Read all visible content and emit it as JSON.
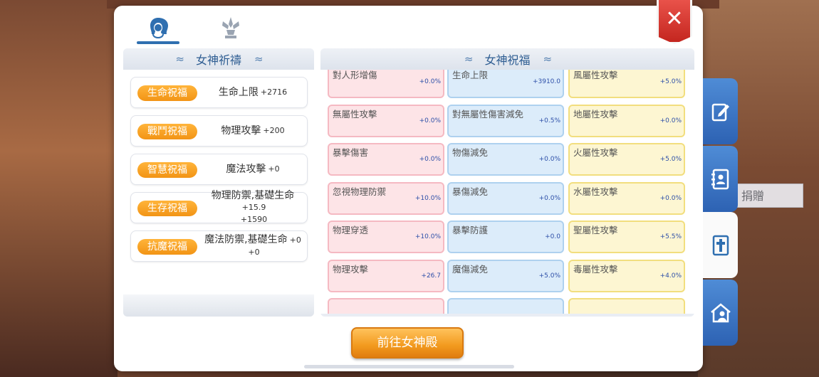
{
  "background": {
    "donate_text": "捐贈"
  },
  "tabs": [
    {
      "icon": "goddess-head-icon",
      "active": true
    },
    {
      "icon": "statue-crystal-icon",
      "active": false
    }
  ],
  "close_icon": "close-icon",
  "left_panel": {
    "title": "女神祈禱",
    "rows": [
      {
        "label": "生命祝福",
        "stat": "生命上限",
        "value": "+2716"
      },
      {
        "label": "戰鬥祝福",
        "stat": "物理攻擊",
        "value": "+200"
      },
      {
        "label": "智慧祝福",
        "stat": "魔法攻擊",
        "value": "+0"
      },
      {
        "label": "生存祝福",
        "stat": "物理防禦,基礎生命",
        "value": "+15.9",
        "value2": "+1590"
      },
      {
        "label": "抗魔祝福",
        "stat": "魔法防禦,基礎生命",
        "value": "+0",
        "value2": "+0"
      }
    ]
  },
  "right_panel": {
    "title": "女神祝福",
    "columns": [
      {
        "color": "#fde4e7",
        "cells": [
          {
            "name": "對人形增傷",
            "value": "+0.0%"
          },
          {
            "name": "無屬性攻擊",
            "value": "+0.0%"
          },
          {
            "name": "暴擊傷害",
            "value": "+0.0%"
          },
          {
            "name": "忽視物理防禦",
            "value": "+10.0%"
          },
          {
            "name": "物理穿透",
            "value": "+10.0%"
          },
          {
            "name": "物理攻擊",
            "value": "+26.7"
          },
          {
            "name": "",
            "value": ""
          }
        ]
      },
      {
        "color": "#dcecfa",
        "cells": [
          {
            "name": "生命上限",
            "value": "+3910.0"
          },
          {
            "name": "對無屬性傷害減免",
            "value": "+0.5%"
          },
          {
            "name": "物傷減免",
            "value": "+0.0%"
          },
          {
            "name": "暴傷減免",
            "value": "+0.0%"
          },
          {
            "name": "暴擊防護",
            "value": "+0.0"
          },
          {
            "name": "魔傷減免",
            "value": "+5.0%"
          },
          {
            "name": "",
            "value": ""
          }
        ]
      },
      {
        "color": "#fdf6d2",
        "cells": [
          {
            "name": "風屬性攻擊",
            "value": "+5.0%"
          },
          {
            "name": "地屬性攻擊",
            "value": "+0.0%"
          },
          {
            "name": "火屬性攻擊",
            "value": "+5.0%"
          },
          {
            "name": "水屬性攻擊",
            "value": "+0.0%"
          },
          {
            "name": "聖屬性攻擊",
            "value": "+5.5%"
          },
          {
            "name": "毒屬性攻擊",
            "value": "+4.0%"
          },
          {
            "name": "",
            "value": ""
          }
        ]
      }
    ]
  },
  "action_button": {
    "label": "前往女神殿"
  },
  "side_tabs": [
    {
      "icon": "edit-note-icon",
      "active": false
    },
    {
      "icon": "contacts-book-icon",
      "active": false
    },
    {
      "icon": "cross-tablet-icon",
      "active": true
    },
    {
      "icon": "home-user-icon",
      "active": false
    }
  ]
}
